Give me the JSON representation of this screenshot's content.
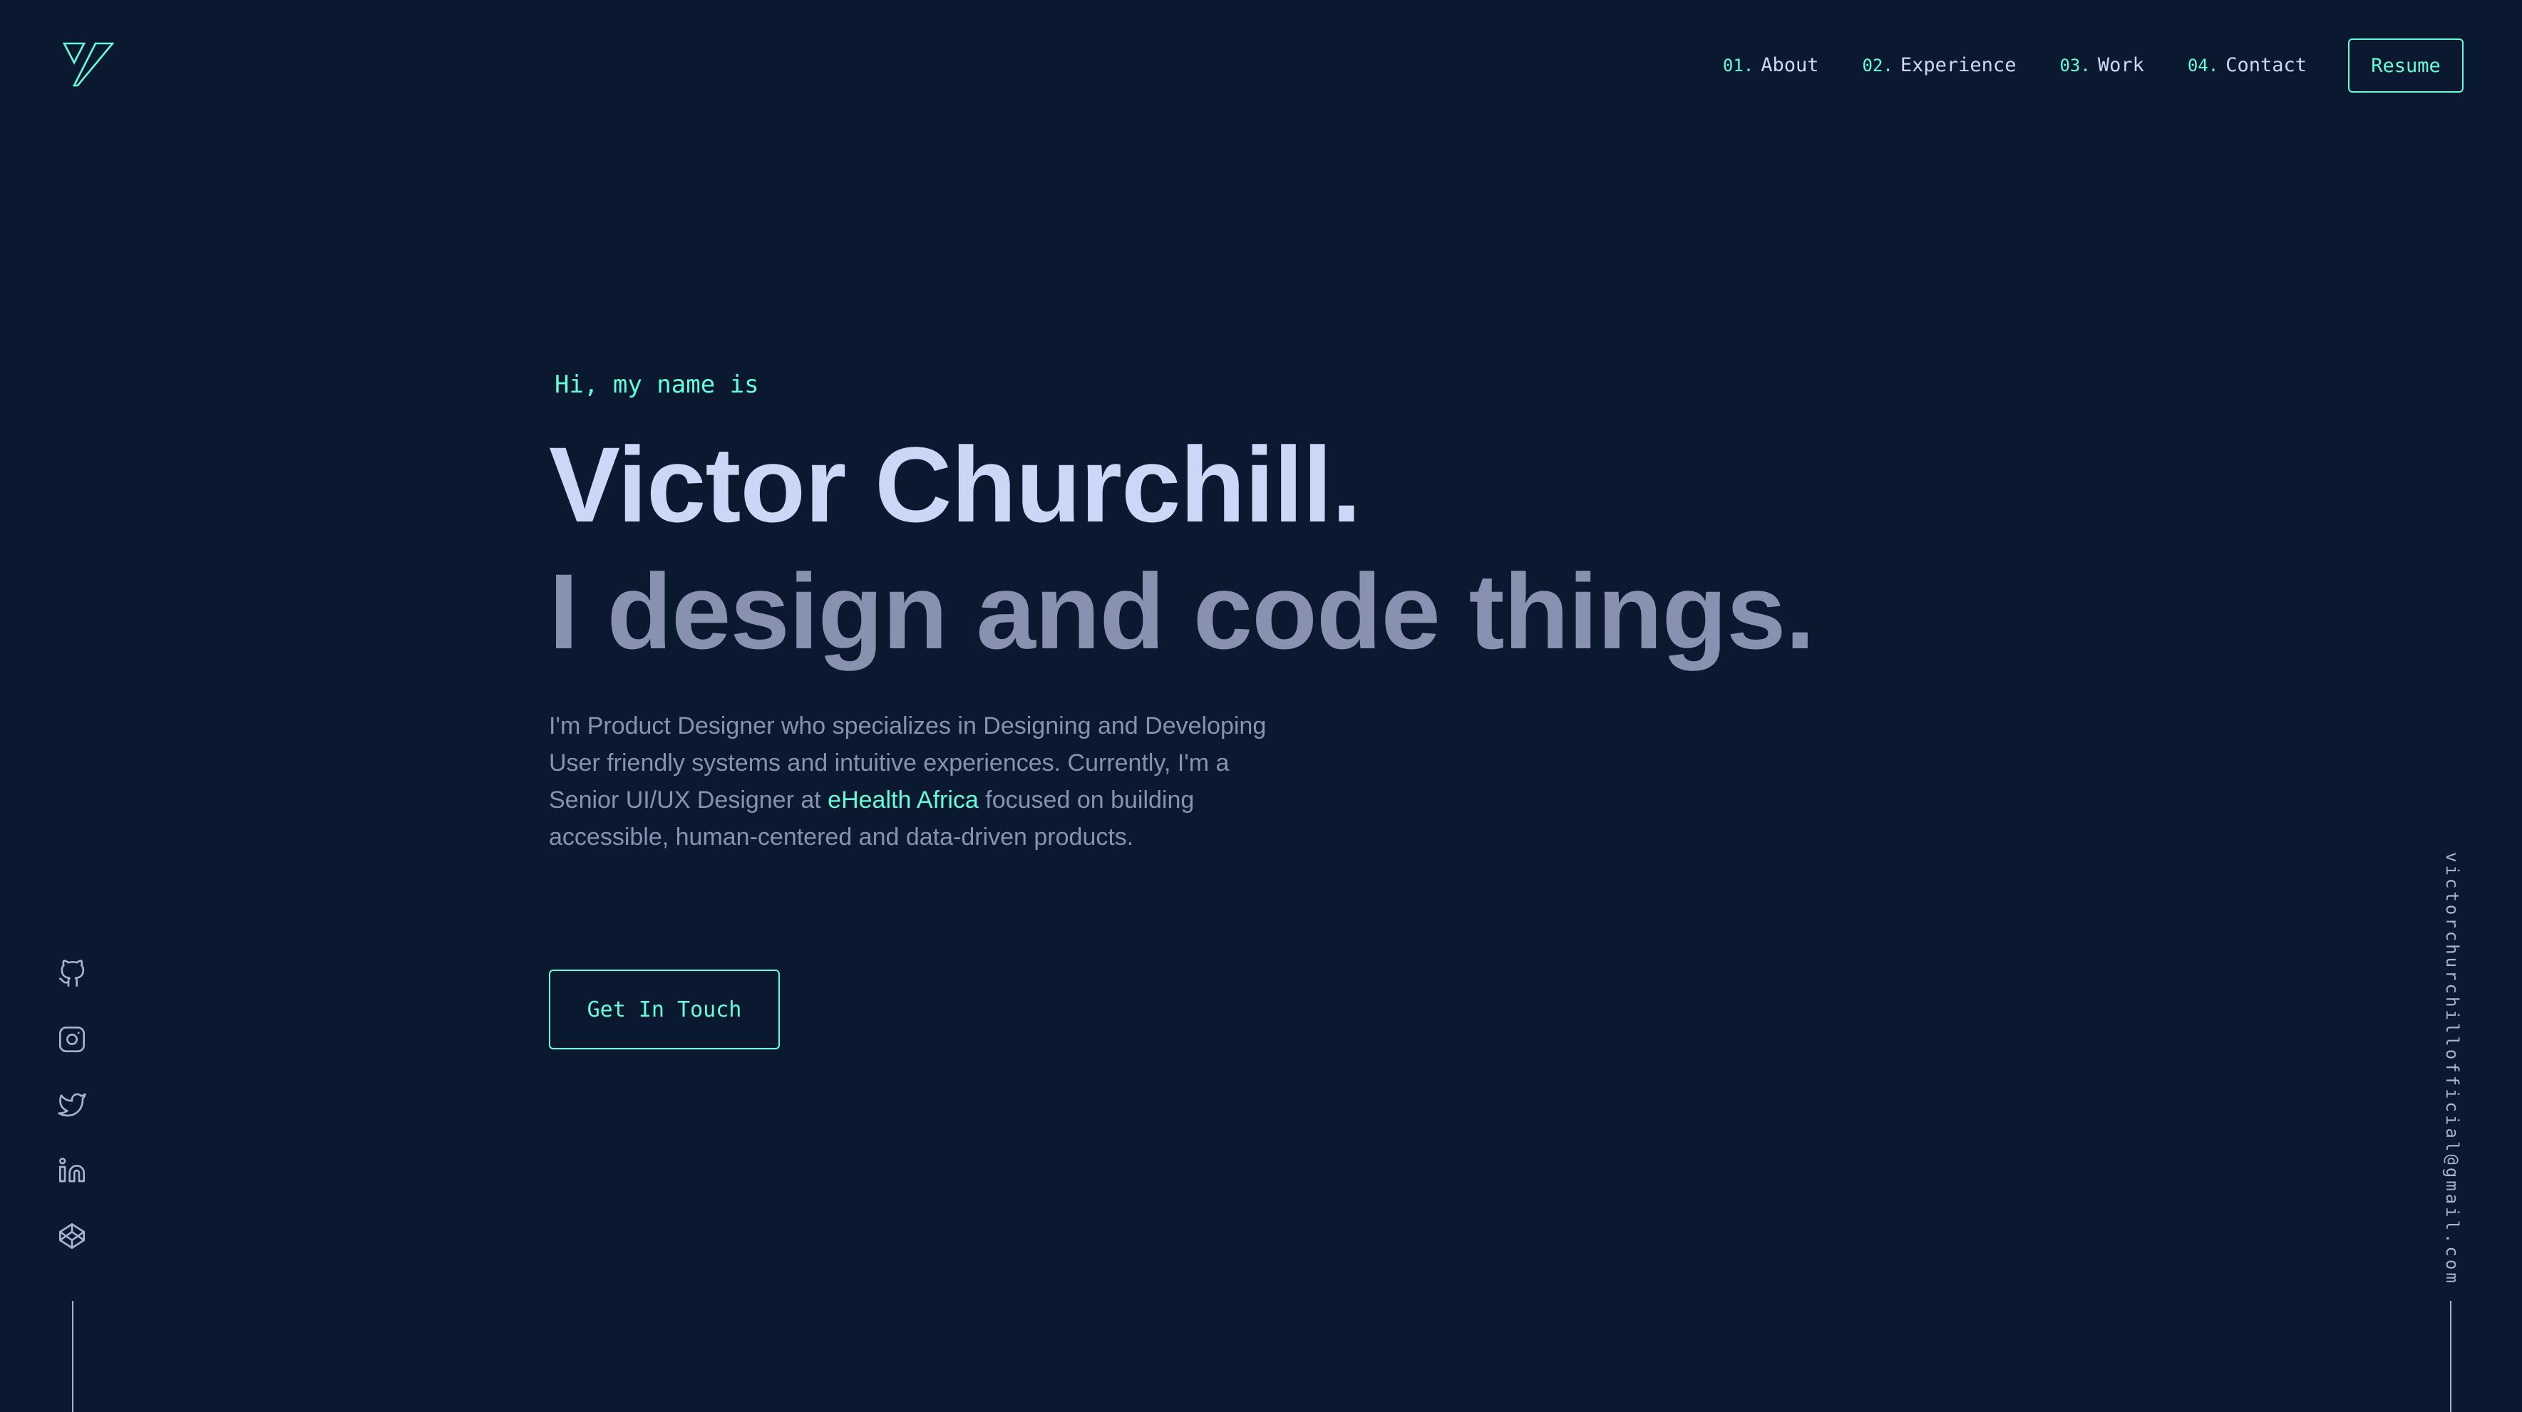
{
  "header": {
    "logo_icon": "vc-monogram-logo",
    "nav": [
      {
        "number": "01.",
        "label": "About"
      },
      {
        "number": "02.",
        "label": "Experience"
      },
      {
        "number": "03.",
        "label": "Work"
      },
      {
        "number": "04.",
        "label": "Contact"
      }
    ],
    "resume_label": "Resume"
  },
  "hero": {
    "intro": "Hi, my name is",
    "name": "Victor Churchill.",
    "tagline": "I design and code things.",
    "bio_before": "I'm Product Designer who specializes in Designing and Developing User friendly systems and intuitive experiences. Currently, I'm a Senior UI/UX Designer at ",
    "bio_link": "eHealth Africa",
    "bio_after": " focused on building accessible, human-centered and data-driven products.",
    "cta_label": "Get In Touch"
  },
  "social": [
    "github-icon",
    "instagram-icon",
    "twitter-icon",
    "linkedin-icon",
    "codepen-icon"
  ],
  "email": "victorchurchillofficial@gmail.com",
  "colors": {
    "background": "#0a192f",
    "accent": "#64ffda",
    "heading": "#ccd6f6",
    "text": "#8892b0"
  }
}
